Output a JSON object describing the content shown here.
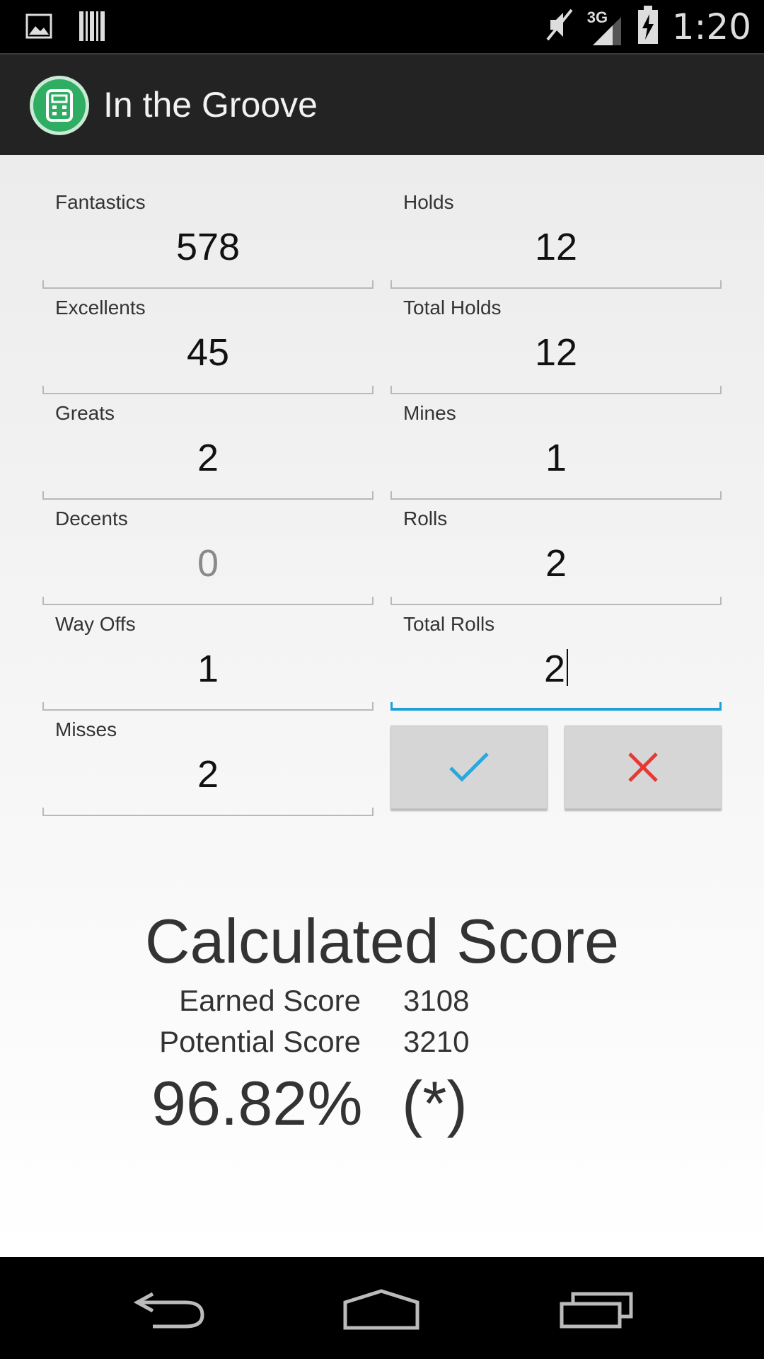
{
  "status_bar": {
    "time": "1:20",
    "network": "3G",
    "icons": [
      "image-icon",
      "barcode-icon",
      "mute-icon",
      "signal-icon",
      "battery-charging-icon"
    ]
  },
  "app_bar": {
    "title": "In the Groove",
    "icon": "calculator-icon",
    "accent_color": "#2fae63"
  },
  "form": {
    "fantastics": {
      "label": "Fantastics",
      "value": "578"
    },
    "holds": {
      "label": "Holds",
      "value": "12"
    },
    "excellents": {
      "label": "Excellents",
      "value": "45"
    },
    "total_holds": {
      "label": "Total Holds",
      "value": "12"
    },
    "greats": {
      "label": "Greats",
      "value": "2"
    },
    "mines": {
      "label": "Mines",
      "value": "1"
    },
    "decents": {
      "label": "Decents",
      "placeholder": "0"
    },
    "rolls": {
      "label": "Rolls",
      "value": "2"
    },
    "way_offs": {
      "label": "Way Offs",
      "value": "1"
    },
    "total_rolls": {
      "label": "Total Rolls",
      "value": "2"
    },
    "misses": {
      "label": "Misses",
      "value": "2"
    }
  },
  "actions": {
    "confirm_icon": "check-icon",
    "confirm_color": "#2aa7dc",
    "cancel_icon": "close-icon",
    "cancel_color": "#e53935"
  },
  "result": {
    "title": "Calculated Score",
    "earned_label": "Earned Score",
    "earned_value": "3108",
    "potential_label": "Potential Score",
    "potential_value": "3210",
    "percent": "96.82%",
    "note": "(*)"
  },
  "nav_bar": {
    "icons": [
      "back-icon",
      "home-icon",
      "recents-icon"
    ]
  }
}
